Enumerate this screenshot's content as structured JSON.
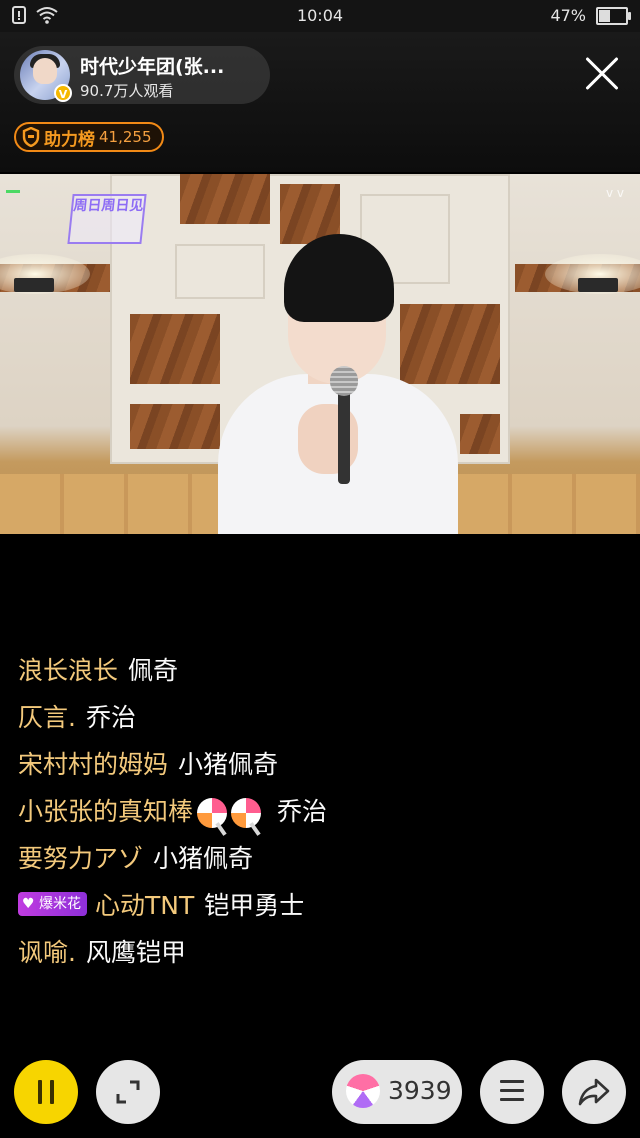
{
  "status_bar": {
    "time": "10:04",
    "battery": "47%",
    "battery_level": 0.47
  },
  "header": {
    "host_name": "时代少年团(张...",
    "viewer_count": "90.7万人观看",
    "verified_badge": "V",
    "support_label": "助力榜",
    "support_count": "41,255"
  },
  "video": {
    "sign_text": "周日周日见"
  },
  "chat": {
    "messages": [
      {
        "name": "浪长浪长",
        "text": "佩奇"
      },
      {
        "name": "仄言.",
        "text": "乔治"
      },
      {
        "name": "宋村村的姆妈",
        "text": "小猪佩奇"
      },
      {
        "name": "小张张的真知棒",
        "text": "乔治",
        "icons": [
          "lollipop-icon",
          "lollipop-icon"
        ]
      },
      {
        "name": "要努力アゾ",
        "text": "小猪佩奇"
      },
      {
        "badge": "爆米花",
        "name": "心动TNT",
        "text": "铠甲勇士"
      },
      {
        "name": "讽喻.",
        "text": "风鹰铠甲"
      }
    ]
  },
  "bottom_bar": {
    "candy_count": "3939"
  },
  "colors": {
    "accent_yellow": "#f7d500",
    "username": "#f3c97c",
    "support_orange": "#f28a16"
  }
}
